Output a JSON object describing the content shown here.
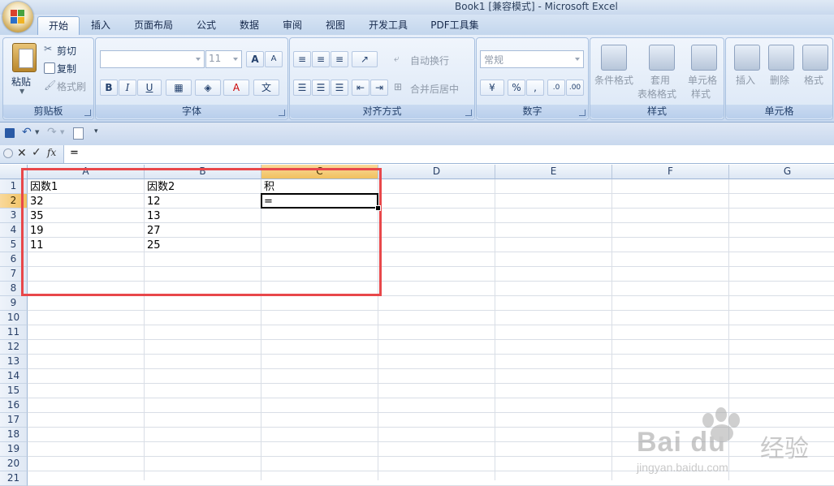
{
  "window": {
    "title": "Book1  [兼容模式] - Microsoft Excel"
  },
  "ribbon": {
    "tabs": [
      "开始",
      "插入",
      "页面布局",
      "公式",
      "数据",
      "审阅",
      "视图",
      "开发工具",
      "PDF工具集"
    ],
    "active_tab": "开始",
    "clipboard": {
      "group_label": "剪贴板",
      "paste": "粘贴",
      "cut": "剪切",
      "copy": "复制",
      "format_painter": "格式刷"
    },
    "font": {
      "group_label": "字体",
      "font_size": "11",
      "bold": "B",
      "italic": "I",
      "underline": "U",
      "grow": "A",
      "shrink": "A"
    },
    "alignment": {
      "group_label": "对齐方式",
      "wrap_text": "自动换行",
      "merge_center": "合并后居中"
    },
    "number": {
      "group_label": "数字",
      "format": "常规",
      "percent": "%",
      "comma": ","
    },
    "styles": {
      "group_label": "样式",
      "conditional_line1": "条件格式",
      "table_line1": "套用",
      "table_line2": "表格格式",
      "cell_line1": "单元格",
      "cell_line2": "样式"
    },
    "cells": {
      "group_label": "单元格",
      "insert": "插入",
      "delete": "删除",
      "format": "格式"
    }
  },
  "formula_bar": {
    "fx": "fx",
    "content": "="
  },
  "sheet": {
    "columns": [
      "A",
      "B",
      "C",
      "D",
      "E",
      "F",
      "G"
    ],
    "rows": [
      "1",
      "2",
      "3",
      "4",
      "5",
      "6",
      "7",
      "8",
      "9",
      "10",
      "11",
      "12",
      "13",
      "14",
      "15",
      "16",
      "17",
      "18",
      "19",
      "20",
      "21"
    ],
    "selected_column": "C",
    "selected_row": "2",
    "cells": {
      "A1": "因数1",
      "B1": "因数2",
      "C1": "积",
      "A2": "32",
      "B2": "12",
      "C2": "=",
      "A3": "35",
      "B3": "13",
      "A4": "19",
      "B4": "27",
      "A5": "11",
      "B5": "25"
    }
  },
  "watermark": {
    "brand": "Bai du",
    "cn": "经验",
    "url": "jingyan.baidu.com"
  },
  "colors": {
    "selection_highlight": "#f1c15f",
    "annotation_red": "#e8474a",
    "ribbon_blue": "#d5e3f4"
  }
}
